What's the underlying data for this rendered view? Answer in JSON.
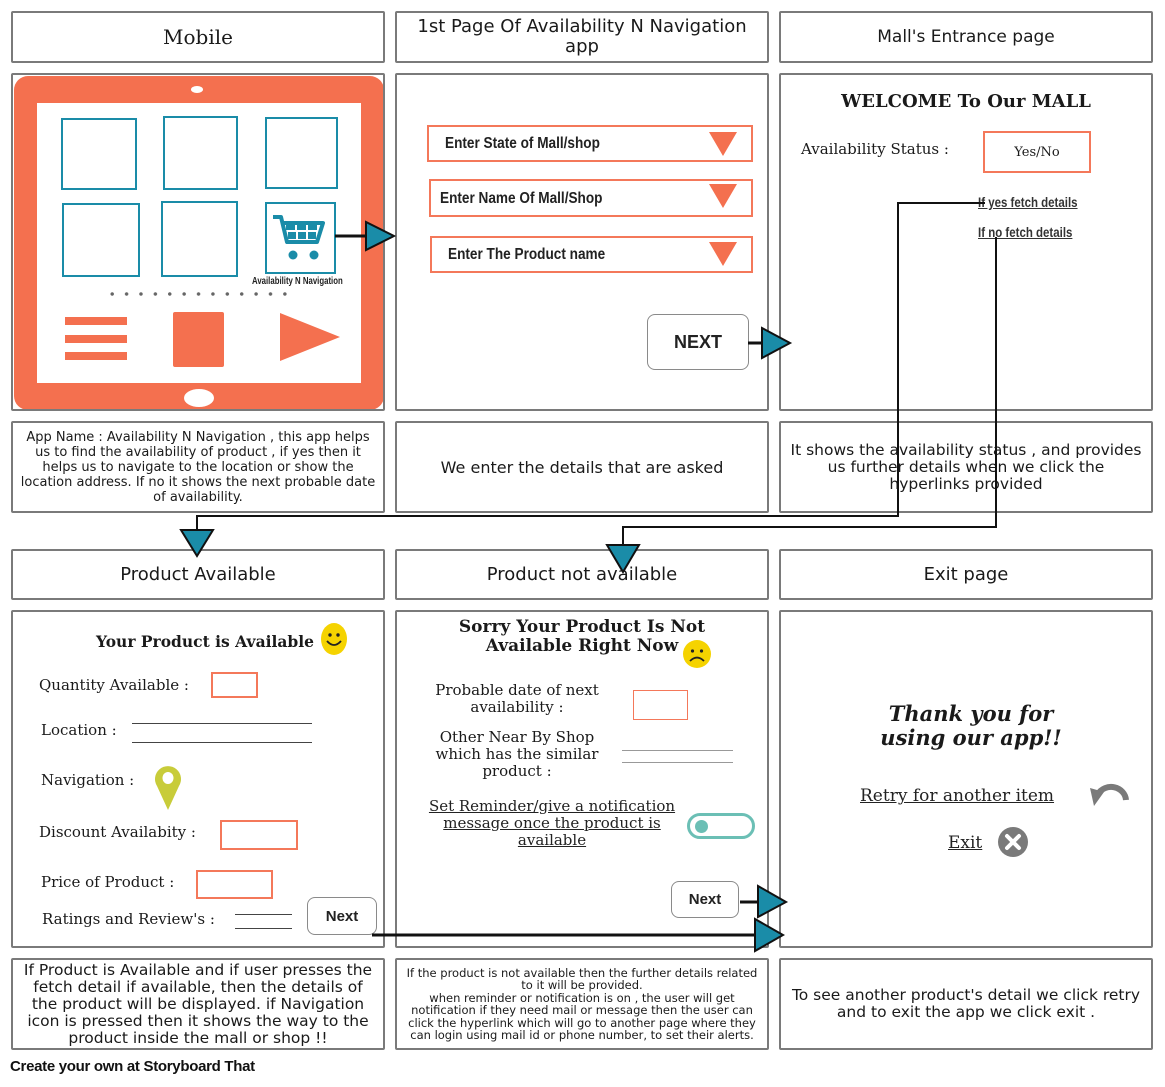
{
  "panels": {
    "row1_titles": [
      "Mobile",
      "1st Page Of Availability N Navigation app",
      "Mall's Entrance page"
    ],
    "row1_descriptions": [
      "App Name : Availability N Navigation , this app helps us to find the availability of product , if yes then it helps us to navigate to the location or show the location address. If no it shows the next probable date of availability.",
      "We enter the details that are asked",
      "It shows the availability status , and provides us further details when we click the hyperlinks provided"
    ],
    "row2_titles": [
      "Product Available",
      "Product not available",
      "Exit page"
    ],
    "row2_descriptions": [
      "If Product is Available and if user presses the fetch detail if available, then the details of the product will be displayed. if Navigation icon is pressed then it shows the way to the product inside the mall or shop !!",
      "If the product is not available then the further details related to it will be provided.\nwhen reminder or notification is on , the user will get notification if they need mail or message then the user can click the hyperlink which will go to another page where they can login using mail id or phone number, to set their alerts.",
      "To see another product's detail we click retry and to exit the app we click exit ."
    ]
  },
  "mobile": {
    "app_icon_label": "Availability N Navigation",
    "app_icon": "shopping-cart-icon",
    "bottom_icons": [
      "menu-icon",
      "square-icon",
      "play-icon"
    ],
    "colors": {
      "frame": "#f4704f",
      "tile_border": "#1a8ca8",
      "arrow": "#1a8ca8"
    }
  },
  "first_page": {
    "dropdowns": [
      {
        "placeholder": "Enter State of Mall/shop",
        "icon": "triangle-down-icon"
      },
      {
        "placeholder": "Enter Name Of Mall/Shop",
        "icon": "triangle-down-icon"
      },
      {
        "placeholder": "Enter The Product name",
        "icon": "triangle-down-icon"
      }
    ],
    "next_label": "NEXT"
  },
  "mall_entrance": {
    "heading": "WELCOME To Our MALL",
    "status_label": "Availability Status :",
    "status_value": "Yes/No",
    "link_yes": "If yes fetch details",
    "link_no": "If no fetch details"
  },
  "product_available": {
    "heading": "Your Product is Available",
    "heading_icon": "smiley-happy-icon",
    "quantity_label": "Quantity Available :",
    "location_label": "Location :",
    "navigation_label": "Navigation :",
    "navigation_icon": "map-pin-icon",
    "discount_label": "Discount Availabity :",
    "price_label": "Price of Product :",
    "ratings_label": "Ratings and Review's :",
    "next_label": "Next"
  },
  "product_not_available": {
    "heading_line1": "Sorry Your Product Is Not",
    "heading_line2": "Available Right Now",
    "heading_icon": "smiley-sad-icon",
    "date_label": "Probable date of next availability :",
    "nearby_label": "Other Near By Shop which has the similar product :",
    "reminder_link": "Set Reminder/give a notification message once the product is available",
    "reminder_toggle_on": false,
    "next_label": "Next"
  },
  "exit_page": {
    "thank_you": "Thank you for using our app!!",
    "retry_label": "Retry for another item",
    "retry_icon": "undo-arrow-icon",
    "exit_label": "Exit",
    "exit_icon": "close-circle-icon"
  },
  "footer": "Create your own at Storyboard That"
}
